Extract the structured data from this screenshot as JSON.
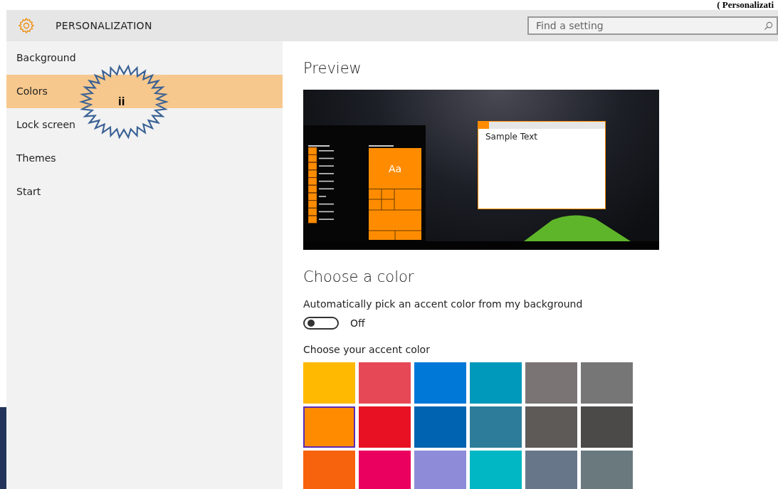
{
  "caption": {
    "text": "( Personalizati"
  },
  "header": {
    "title": "PERSONALIZATION",
    "search": {
      "placeholder": "Find a setting"
    }
  },
  "sidebar": {
    "items": [
      {
        "label": "Background",
        "selected": false
      },
      {
        "label": "Colors",
        "selected": true
      },
      {
        "label": "Lock screen",
        "selected": false
      },
      {
        "label": "Themes",
        "selected": false
      },
      {
        "label": "Start",
        "selected": false
      }
    ]
  },
  "callout": {
    "label": "ii"
  },
  "preview": {
    "heading": "Preview",
    "tile_text": "Aa",
    "window_text": "Sample Text"
  },
  "colors": {
    "heading": "Choose a color",
    "auto_label": "Automatically pick an accent color from my background",
    "toggle": {
      "on": false,
      "reading": "Off"
    },
    "accent_label": "Choose your accent color",
    "swatches": [
      {
        "color": "#ffb900",
        "selected": false
      },
      {
        "color": "#e74856",
        "selected": false
      },
      {
        "color": "#0078d7",
        "selected": false
      },
      {
        "color": "#0099bc",
        "selected": false
      },
      {
        "color": "#7a7574",
        "selected": false
      },
      {
        "color": "#767676",
        "selected": false
      },
      {
        "color": "#ff8c00",
        "selected": true
      },
      {
        "color": "#e81123",
        "selected": false
      },
      {
        "color": "#0063b1",
        "selected": false
      },
      {
        "color": "#2d7d9a",
        "selected": false
      },
      {
        "color": "#5d5a58",
        "selected": false
      },
      {
        "color": "#4c4a48",
        "selected": false
      },
      {
        "color": "#f7630c",
        "selected": false
      },
      {
        "color": "#ea005e",
        "selected": false
      },
      {
        "color": "#8e8cd8",
        "selected": false
      },
      {
        "color": "#00b7c3",
        "selected": false
      },
      {
        "color": "#68768a",
        "selected": false
      },
      {
        "color": "#69797e",
        "selected": false
      }
    ]
  }
}
